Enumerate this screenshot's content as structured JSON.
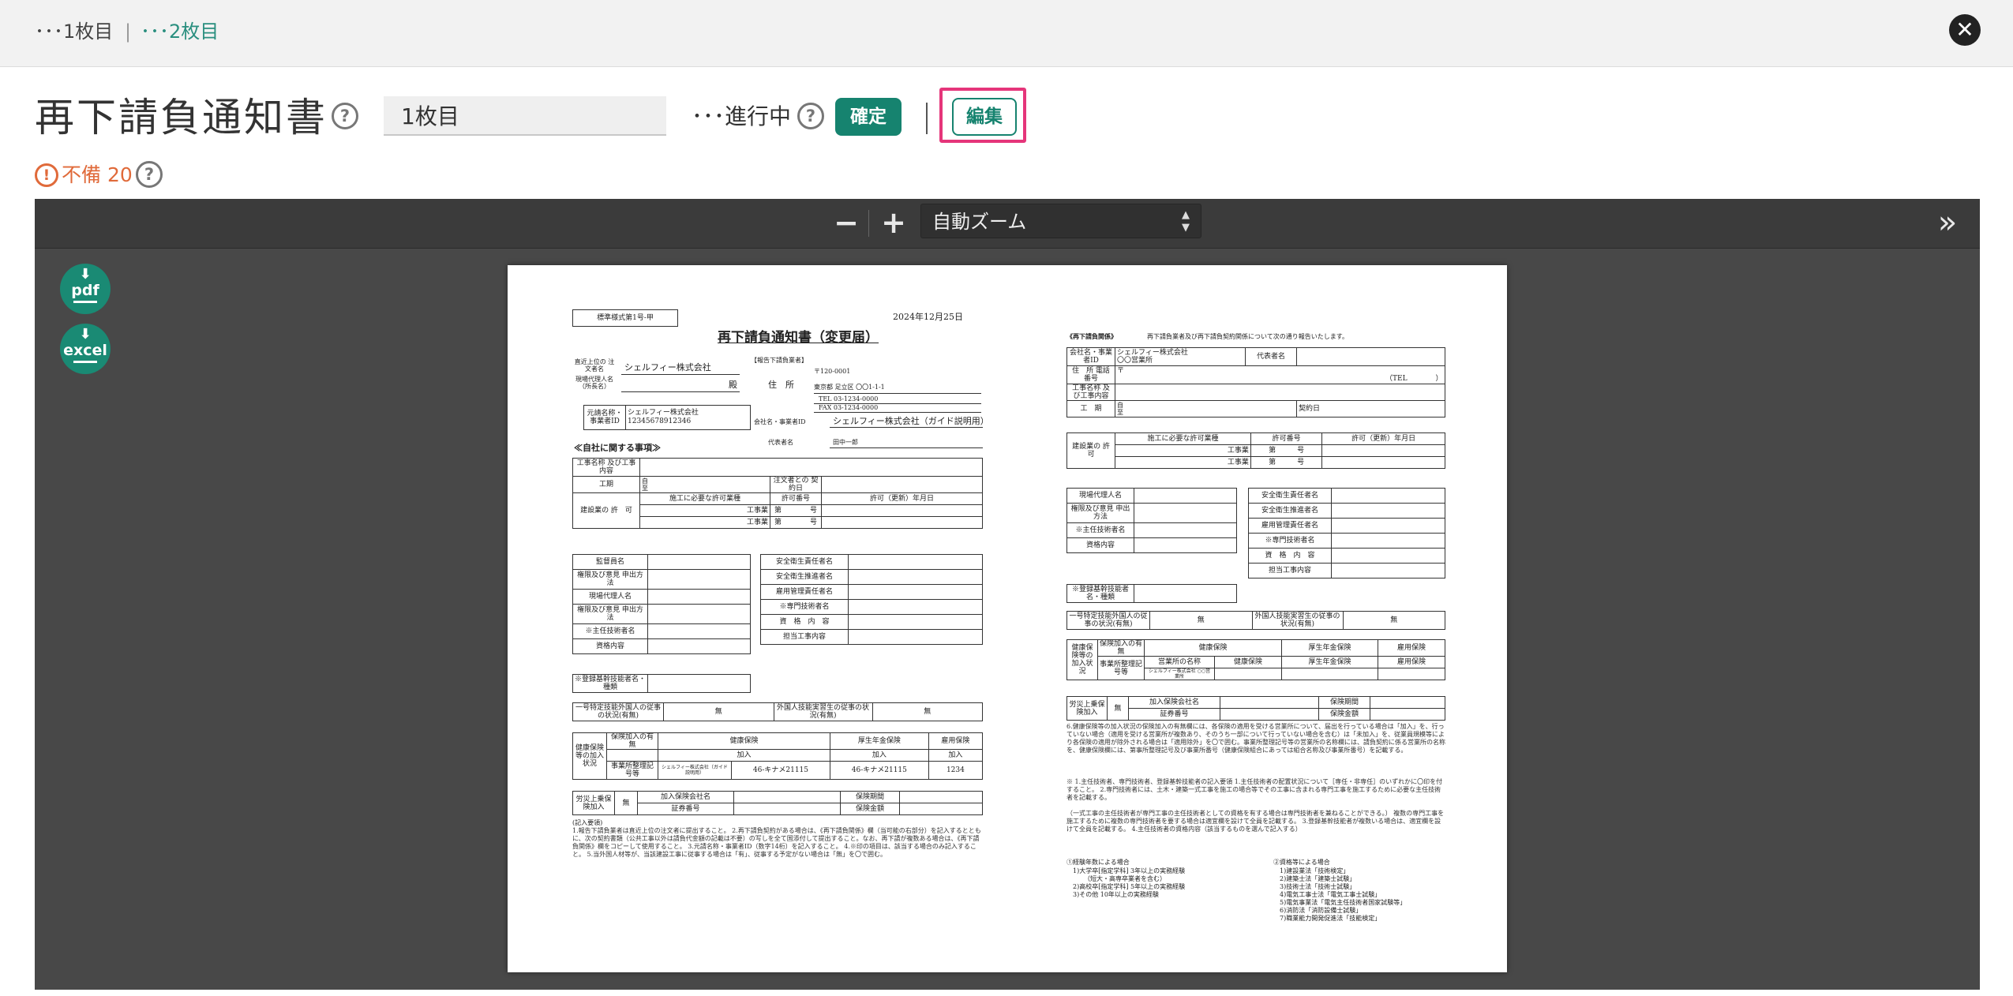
{
  "header": {
    "crumb_1": "･･･1枚目",
    "crumb_separator": "|",
    "crumb_2": "･･･2枚目",
    "close_icon": "close-icon"
  },
  "toolbar": {
    "title": "再下請負通知書",
    "help_icon": "?",
    "page_value": "1枚目",
    "status": "･･･進行中",
    "confirm_label": "確定",
    "edit_label": "編集",
    "warning_icon": "!",
    "warning_text": "不備 20"
  },
  "viewer": {
    "zoom_minus": "−",
    "zoom_plus": "+",
    "zoom_select": "自動ズーム",
    "sidebar_toggle": "»",
    "pdf_label": "pdf",
    "excel_label": "excel"
  },
  "document": {
    "left": {
      "form_no": "標準様式第1号-甲",
      "date": "2024年12月25日",
      "title": "再下請負通知書（変更届）",
      "reporter_label": "【報告下請負業者】",
      "to_label": "直近上位の 注文者名",
      "agent_label": "現場代理人名 （所長名）",
      "client_name": "シェルフィー株式会社",
      "honorific": "殿",
      "address_label": "住　所",
      "postal": "〒120-0001",
      "address": "東京都 足立区 〇〇1-1-1",
      "tel": "TEL 03-1234-0000",
      "fax": "FAX 03-1234-0000",
      "company_label": "会社名・事業者ID",
      "company": "シェルフィー株式会社（ガイド説明用）",
      "rep_label": "代表者名",
      "rep": "田中一郎",
      "prime_label": "元請名称・ 事業者ID",
      "prime_name": "シェルフィー株式会社",
      "prime_id": "12345678912346",
      "section_self": "≪自社に関する事項≫",
      "row_work_name": "工事名称 及び工事内容",
      "row_period": "工期",
      "period_from": "自",
      "period_to": "至",
      "contract_date": "注文者との 契約日",
      "license_label": "建設業の 許　可",
      "license_col1": "施工に必要な許可業種",
      "license_col2": "許可番号",
      "license_col3": "許可（更新）年月日",
      "license_work": "工事業",
      "license_no": "第　　　　号",
      "supervisor": "監督員名",
      "authority": "権限及び意見 申出方法",
      "site_agent": "現場代理人名",
      "chief_engineer": "※主任技術者名",
      "qualification": "資格内容",
      "safety_manager": "安全衛生責任者名",
      "safety_promoter": "安全衛生推進者名",
      "employment_manager": "雇用管理責任者名",
      "specialist": "※専門技術者名",
      "spec_qualification": "資　格　内　容",
      "spec_work": "担当工事内容",
      "registered": "※登録基幹技能者名・種類",
      "foreign_1": "一号特定技能外国人の従事の状況(有無)",
      "foreign_none_1": "無",
      "foreign_2": "外国人技能実習生の従事の状況(有無)",
      "foreign_none_2": "無",
      "insurance_label": "健康保険等の加入状況",
      "ins_join": "保険加入の有無",
      "ins_health": "健康保険",
      "ins_pension": "厚生年金保険",
      "ins_employment": "雇用保険",
      "ins_joined": "加入",
      "ins_office_label": "事業所整理記号等",
      "ins_office": "営業所の名称",
      "ins_office_name": "シェルフィー株式会社（ガイド説明用）",
      "ins_health_no": "46-キナメ21115",
      "ins_pension_no": "46-キナメ21115",
      "ins_employment_no": "1234",
      "workers_comp": "労災上乗保険加入",
      "workers_none": "無",
      "ins_company": "加入保険会社名",
      "ins_number": "証券番号",
      "ins_period": "保険期間",
      "ins_amount": "保険金額",
      "notes_title": "(記入要領)",
      "notes": "1.報告下請負業者は直近上位の注文者に提出すること。 2.再下請負契約がある場合は、《再下請負関係》欄（当可能の右部分）を記入するとともに、次の契約書類（公共工事以外は請負代金額の記載は不要）の写しを全て国添付して提出すること。なお、再下請が複数ある場合は、《再下請負関係》欄をコピーして使用すること。 3.元請名称・事業者ID（数字14桁）を記入すること。 4.※印の項目は、該当する場合のみ記入すること。 5.当外国人材等が、当該建設工事に従事する場合は「有」、従事する予定がない場合は「無」を〇で囲む。"
    },
    "right": {
      "section": "《再下請負関係》",
      "section_note": "再下請負業者及び再下請負契約関係について次の通り報告いたします。",
      "company_label": "会社名・事業者ID",
      "company": "シェルフィー株式会社",
      "branch": "〇〇営業所",
      "rep_label": "代表者名",
      "address_label": "住　所 電話番号",
      "postal_mark": "〒",
      "tel_label": "（TEL　　　　）",
      "work_label": "工事名称 及び工事内容",
      "period_label": "工　期",
      "period_from": "自",
      "period_to": "至",
      "contract_label": "契約日",
      "license_label": "建設業の 許　可",
      "license_col1": "施工に必要な許可業種",
      "license_col2": "許可番号",
      "license_col3": "許可（更新）年月日",
      "license_work": "工事業",
      "license_no": "第　　　号",
      "site_agent": "現場代理人名",
      "authority": "権限及び意見 申出方法",
      "chief_engineer": "※主任技術者名",
      "qualification": "資格内容",
      "safety_manager": "安全衛生責任者名",
      "safety_promoter": "安全衛生推進者名",
      "employment_manager": "雇用管理責任者名",
      "specialist": "※専門技術者名",
      "spec_qualification": "資　格　内　容",
      "spec_work": "担当工事内容",
      "registered": "※登録基幹技能者名・種類",
      "foreign_1": "一号特定技能外国人の従事の状況(有無)",
      "foreign_none_1": "無",
      "foreign_2": "外国人技能実習生の従事の状況(有無)",
      "foreign_none_2": "無",
      "insurance_label": "健康保険等の加入状況",
      "ins_join": "保険加入の有無",
      "ins_health": "健康保険",
      "ins_pension": "厚生年金保険",
      "ins_employment": "雇用保険",
      "ins_office_label": "事業所整理記号等",
      "ins_office": "営業所の名称",
      "ins_office_name": "シェルフィー株式会社 ○○営業所",
      "workers_comp": "労災上乗保険加入",
      "workers_none": "無",
      "ins_company": "加入保険会社名",
      "ins_number": "証券番号",
      "ins_period": "保険期間",
      "ins_amount": "保険金額",
      "notes_1": "6.健康保険等の加入状況の保険加入の有無欄には、各保険の適用を受ける営業所について、届出を行っている場合は「加入」を、行っていない場合（適用を受ける営業所が複数あり、そのうち一部について行っていない場合を含む）は「未加入」を、従業員規模等により各保険の適用が除外される場合は「適用除外」を〇で囲む。事業所整理記号等の営業所の名称欄には、請負契約に係る営業所の名称を、健康保険欄には、第事所整理記号及び事業所番号（健康保険組合にあっては組合名称及び事業所番号）を記載する。",
      "notes_2": "※ 1.主任技術者、専門技術者、登録基幹技能者の記入要領 1.主任技術者の配置状況について［専任・非専任］のいずれかに〇印を付すること。 2.専門技術者には、土木・建築一式工事を施工の場合等でその工事に含まれる専門工事を施工するために必要な主任技術者を記載する。",
      "notes_3": "（一式工事の主任技術者が専門工事の主任技術者としての資格を有する場合は専門技術者を兼ねることができる。） 複数の専門工事を施工するために複数の専門技術者を要する場合は適宜欄を設けて全員を記載する。 3.登録基幹技能者が複数いる場合は、適宜欄を設けて全員を記載する。 4.主任技術者の資格内容（該当するものを選んで記入する）",
      "exp_title": "①経験年数による場合",
      "exp_1": "1)大学卒[指定学科] 3年以上の実務経験",
      "exp_1b": "（短大・高専卒業者を含む）",
      "exp_2": "2)高校卒[指定学科] 5年以上の実務経験",
      "exp_3": "3)その他 10年以上の実務経験",
      "cert_title": "②資格等による場合",
      "cert_1": "1)建設業法「技術検定」",
      "cert_2": "2)建築士法「建築士試験」",
      "cert_3": "3)技術士法「技術士試験」",
      "cert_4": "4)電気工事士法「電気工事士試験」",
      "cert_5": "5)電気事業法「電気主任技術者国家試験等」",
      "cert_6": "6)消防法「消防設備士試験」",
      "cert_7": "7)職業能力開発促進法「技能検定」"
    }
  }
}
